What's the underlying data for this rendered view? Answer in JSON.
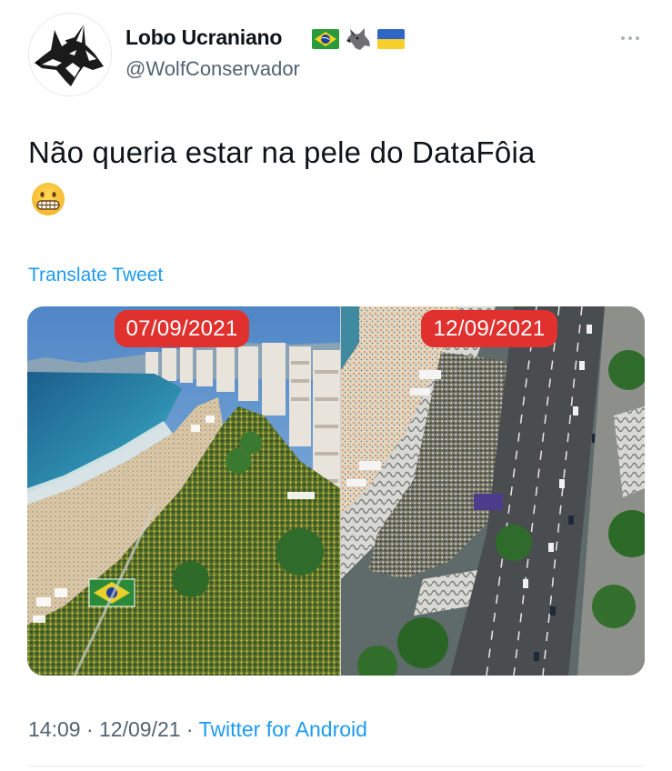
{
  "author": {
    "display_name": "Lobo Ucraniano",
    "handle": "@WolfConservador",
    "name_emojis": [
      "brazil-flag-icon",
      "wolf-icon",
      "ukraine-flag-icon"
    ]
  },
  "tweet": {
    "text": "Não queria estar na pele do DataFôia",
    "emoji": "grimacing-face-icon"
  },
  "translate_label": "Translate Tweet",
  "media": {
    "left_date": "07/09/2021",
    "right_date": "12/09/2021"
  },
  "meta": {
    "time": "14:09",
    "separator": " · ",
    "date": "12/09/21",
    "source": "Twitter for Android"
  },
  "colors": {
    "accent": "#1d9bf0",
    "secondary_text": "#536471",
    "date_label_bg": "#e0312e"
  }
}
